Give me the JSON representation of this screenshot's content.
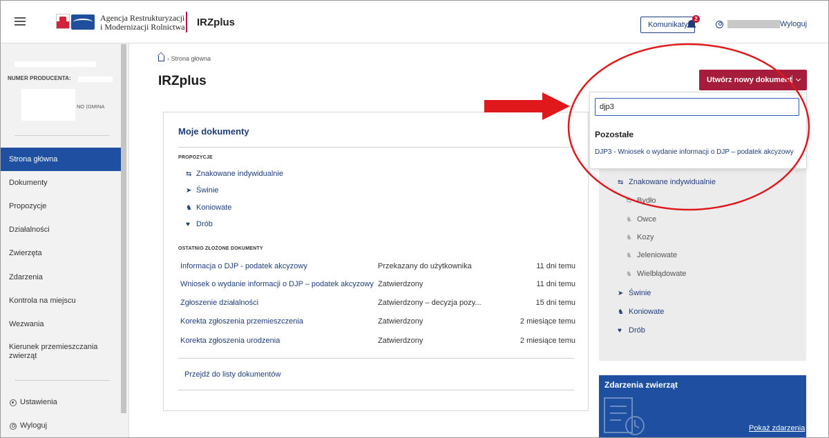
{
  "header": {
    "agency_line1": "Agencja Restrukturyzacji",
    "agency_line2": "i Modernizacji Rolnictwa",
    "app_name": "IRZplus",
    "komunikaty_label": "Komunikaty",
    "notif_count": "2",
    "logout_label": "Wyloguj"
  },
  "sidebar": {
    "producer_label": "NUMER PRODUCENTA:",
    "gmina_text": "NO (GMINA",
    "items": [
      {
        "label": "Strona główna",
        "active": true
      },
      {
        "label": "Dokumenty"
      },
      {
        "label": "Propozycje"
      },
      {
        "label": "Działalności"
      },
      {
        "label": "Zwierzęta"
      },
      {
        "label": "Zdarzenia"
      },
      {
        "label": "Kontrola na miejscu"
      },
      {
        "label": "Wezwania"
      },
      {
        "label": "Kierunek przemieszczania zwierząt"
      }
    ],
    "settings_label": "Ustawienia",
    "logout_label": "Wyloguj"
  },
  "breadcrumb": {
    "current": "Strona główna"
  },
  "page_title": "IRZplus",
  "documents": {
    "title": "Moje dokumenty",
    "proposals_heading": "PROPOZYCJE",
    "proposals": [
      {
        "label": "Znakowane indywidualnie",
        "icon": "cattle-icon"
      },
      {
        "label": "Świnie",
        "icon": "pig-icon"
      },
      {
        "label": "Koniowate",
        "icon": "horse-icon"
      },
      {
        "label": "Drób",
        "icon": "poultry-icon"
      }
    ],
    "recent_heading": "OSTATNIO ZŁOŻONE DOKUMENTY",
    "recent": [
      {
        "name": "Informacja o DJP - podatek akcyzowy",
        "status": "Przekazany do użytkownika",
        "time": "11 dni temu"
      },
      {
        "name": "Wniosek o wydanie informacji o DJP – podatek akcyzowy",
        "status": "Zatwierdzony",
        "time": "11 dni temu"
      },
      {
        "name": "Zgłoszenie działalności",
        "status": "Zatwierdzony – decyzja pozy...",
        "time": "15 dni temu"
      },
      {
        "name": "Korekta zgłoszenia przemieszczenia",
        "status": "Zatwierdzony",
        "time": "2 miesiące temu"
      },
      {
        "name": "Korekta zgłoszenia urodzenia",
        "status": "Zatwierdzony",
        "time": "2 miesiące temu"
      }
    ],
    "all_link": "Przejdź do listy dokumentów"
  },
  "create": {
    "button_label": "Utwórz nowy dokument",
    "search_value": "djp3",
    "group_label": "Pozostałe",
    "option_label": "DJP3 - Wniosek o wydanie informacji o DJP – podatek akcyzowy"
  },
  "animal_tree": [
    {
      "label": "Znakowane indywidualnie",
      "level": 1
    },
    {
      "label": "Bydło",
      "level": 2
    },
    {
      "label": "Owce",
      "level": 2
    },
    {
      "label": "Kozy",
      "level": 2
    },
    {
      "label": "Jeleniowate",
      "level": 2
    },
    {
      "label": "Wielbłądowate",
      "level": 2
    },
    {
      "label": "Świnie",
      "level": 1
    },
    {
      "label": "Koniowate",
      "level": 1
    },
    {
      "label": "Drób",
      "level": 1
    }
  ],
  "events_card": {
    "title": "Zdarzenia zwierząt",
    "link": "Pokaż zdarzenia"
  },
  "colors": {
    "primary_blue": "#1e4fa0",
    "link_blue": "#1f3d7a",
    "accent_red": "#a61d3c",
    "annotation_red": "#e0181b"
  }
}
